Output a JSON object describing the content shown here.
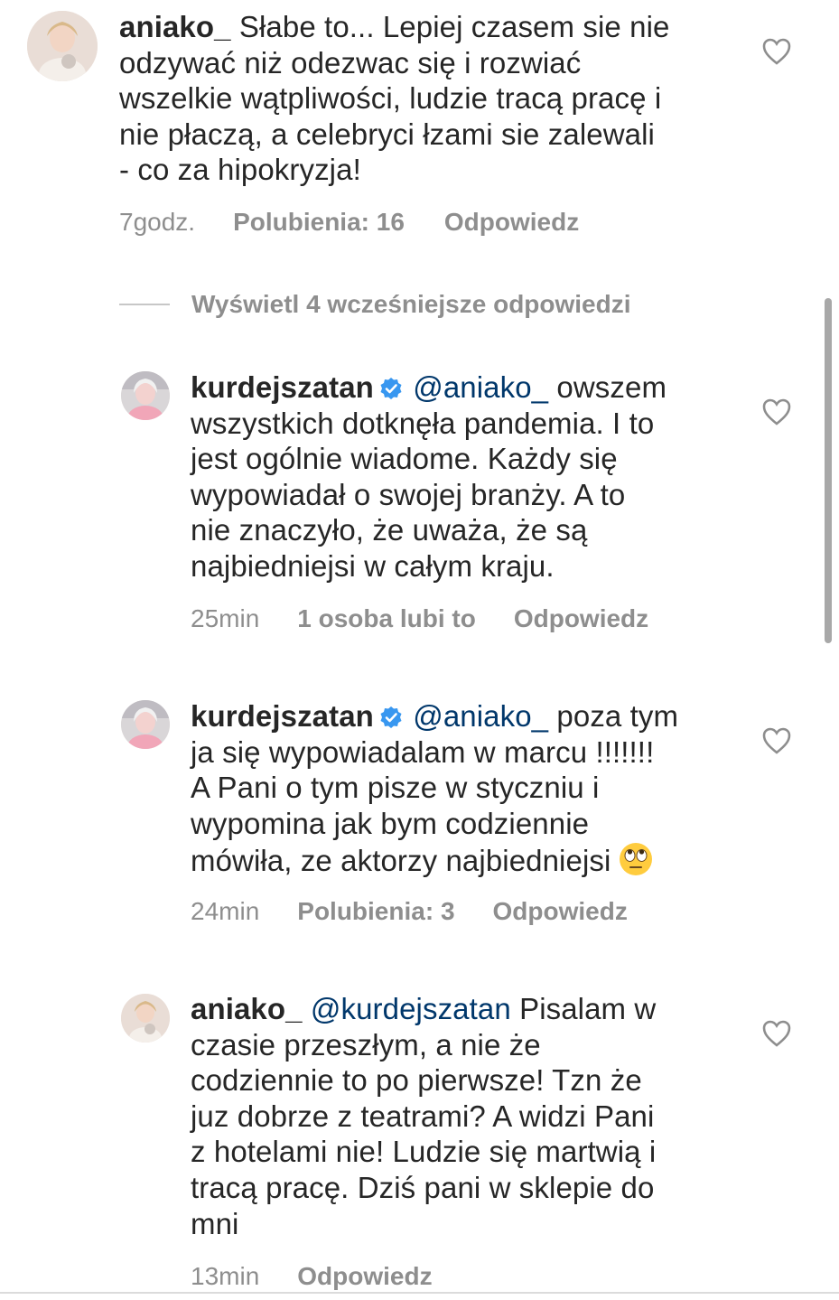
{
  "comments": [
    {
      "username": "aniako_",
      "verified": false,
      "mention": "",
      "text": "Słabe to... Lepiej czasem sie nie\nodzywać niż odezwac się i rozwiać\nwszelkie wątpliwości, ludzie tracą pracę i\nnie płaczą, a celebryci łzami sie zalewali\n- co za hipokryzja!",
      "time": "7godz.",
      "likes": "Polubienia: 16",
      "reply": "Odpowiedz"
    },
    {
      "username": "kurdejszatan",
      "verified": true,
      "mention": "@aniako_",
      "text": " owszem\nwszystkich dotknęła pandemia. I to\njest ogólnie wiadome. Każdy się\nwypowiadał o swojej branży. A to\nnie znaczyło, że uważa, że są\nnajbiedniejsi w całym kraju.",
      "time": "25min",
      "likes": "1 osoba lubi to",
      "reply": "Odpowiedz"
    },
    {
      "username": "kurdejszatan",
      "verified": true,
      "mention": "@aniako_",
      "text": " poza tym\nja się wypowiadalam w marcu !!!!!!!\nA Pani o tym pisze w styczniu i\nwypomina jak bym codziennie\nmówiła, ze aktorzy najbiedniejsi",
      "time": "24min",
      "likes": "Polubienia: 3",
      "reply": "Odpowiedz"
    },
    {
      "username": "aniako_",
      "verified": false,
      "mention": "@kurdejszatan",
      "text": " Pisalam w\nczasie przeszłym, a nie że\ncodziennie to po pierwsze! Tzn że\njuz dobrze z teatrami? A widzi Pani\nz hotelami nie! Ludzie się martwią i\ntracą pracę. Dziś pani w sklepie do\nmni",
      "time": "13min",
      "likes": "",
      "reply": "Odpowiedz"
    }
  ],
  "view_replies_label": "Wyświetl 4 wcześniejsze odpowiedzi",
  "icons": {
    "like": "heart-outline-icon",
    "verified": "verified-badge-icon",
    "emoji": "face-with-rolling-eyes-emoji"
  },
  "colors": {
    "text": "#262626",
    "secondary": "#8e8e8e",
    "mention": "#00376b",
    "verified": "#3897f0"
  }
}
